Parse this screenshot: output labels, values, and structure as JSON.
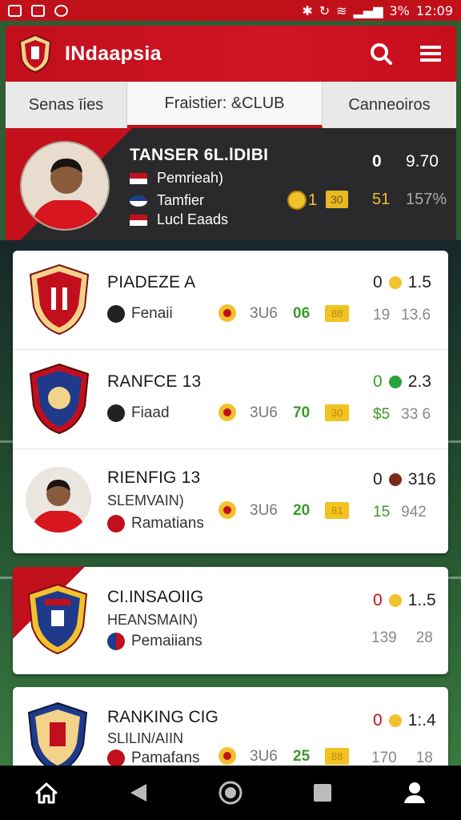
{
  "status_bar": {
    "battery": "3%",
    "time": "12:09"
  },
  "app": {
    "title": "INdaapsia"
  },
  "tabs": [
    {
      "label": "Senas īies"
    },
    {
      "label": "Fraistier: &CLUB"
    },
    {
      "label": "Canneoiros"
    }
  ],
  "featured": {
    "name": "TANSER 6L.lDIBI",
    "lines": [
      "Pemrieah)",
      "Tamfier",
      "Lucl Eaads"
    ],
    "score_a": "0",
    "score_b": "9.70",
    "medal_num": "1",
    "chip": "30",
    "num": "51",
    "pct": "157%"
  },
  "card1": {
    "rows": [
      {
        "title": "PIADEZE A",
        "meta": "Fenaii",
        "code": "3U6",
        "green": "06",
        "chip": "88",
        "stat_a": "19",
        "stat_b": "13.6",
        "rate_a": "0",
        "rate_b": "1.5",
        "dot_color": "#f2c12e"
      },
      {
        "title": "RANFCE 13",
        "meta": "Fiaad",
        "code": "3U6",
        "green": "70",
        "chip": "30",
        "stat_a": "$5",
        "stat_b": "33 6",
        "rate_a": "0",
        "rate_b": "2.3",
        "dot_color": "#29a33a"
      },
      {
        "title": "RIENFIG 13",
        "sub": "SLEMVAIN)",
        "meta": "Ramatians",
        "code": "3U6",
        "green": "20",
        "chip": "81",
        "stat_a": "15",
        "stat_b": "942",
        "rate_a": "0",
        "rate_b": "316",
        "dot_color": "#7a2a1a"
      }
    ]
  },
  "card2": {
    "title": "CI.INSAOIIG",
    "sub": "HEANSMAIN)",
    "meta": "Pemaiians",
    "rate_a": "0",
    "rate_b": "1..5",
    "stat_a": "139",
    "stat_b": "28"
  },
  "card3": {
    "title": "RANKING CIG",
    "sub": "SLILIN/AIIN",
    "meta": "Pamafans",
    "code": "3U6",
    "green": "25",
    "chip": "88",
    "rate_a": "0",
    "rate_b": "1:.4",
    "stat_a": "170",
    "stat_b": "18"
  },
  "colors": {
    "brand_red": "#c20f1d",
    "green": "#3a9a2a",
    "gold": "#f2c12e"
  }
}
